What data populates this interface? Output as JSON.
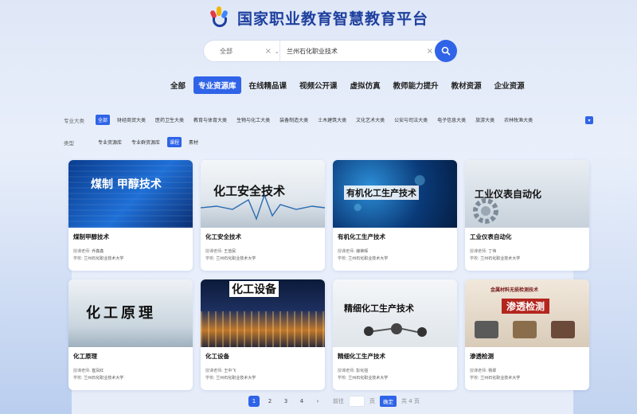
{
  "header": {
    "title": "国家职业教育智慧教育平台"
  },
  "search": {
    "scope_label": "全部",
    "query_value": "兰州石化职业技术"
  },
  "tabs": [
    {
      "label": "全部",
      "active": false
    },
    {
      "label": "专业资源库",
      "active": true
    },
    {
      "label": "在线精品课",
      "active": false
    },
    {
      "label": "视频公开课",
      "active": false
    },
    {
      "label": "虚拟仿真",
      "active": false
    },
    {
      "label": "教师能力提升",
      "active": false
    },
    {
      "label": "教材资源",
      "active": false
    },
    {
      "label": "企业资源",
      "active": false
    }
  ],
  "filters": {
    "category_label": "专业大类",
    "categories": [
      "全部",
      "财经商贸大类",
      "医药卫生大类",
      "教育与体育大类",
      "生物与化工大类",
      "装备制造大类",
      "土木建筑大类",
      "文化艺术大类",
      "公安与司法大类",
      "电子信息大类",
      "旅游大类",
      "农林牧渔大类"
    ],
    "type_label": "类型",
    "types": [
      "专业资源库",
      "专业群资源库",
      "课程",
      "素材"
    ],
    "type_active_index": 2
  },
  "cards": [
    {
      "thumb_text": "煤制 甲醇技术",
      "title": "煤制甲醇技术",
      "teacher_label": "授课老师:",
      "teacher": "乔鑫鑫",
      "school_label": "学校:",
      "school": "兰州石化职业技术大学"
    },
    {
      "thumb_text": "化工安全技术",
      "title": "化工安全技术",
      "teacher_label": "授课老师:",
      "teacher": "王皆民",
      "school_label": "学校:",
      "school": "兰州石化职业技术大学"
    },
    {
      "thumb_text": "有机化工生产技术",
      "title": "有机化工生产技术",
      "teacher_label": "授课老师:",
      "teacher": "薛荣晖",
      "school_label": "学校:",
      "school": "兰州石化职业技术大学"
    },
    {
      "thumb_text": "工业仪表自动化",
      "title": "工业仪表自动化",
      "teacher_label": "授课老师:",
      "teacher": "丁伟",
      "school_label": "学校:",
      "school": "兰州石化职业技术大学"
    },
    {
      "thumb_text": "化工原理",
      "title": "化工原理",
      "teacher_label": "授课老师:",
      "teacher": "崔凤红",
      "school_label": "学校:",
      "school": "兰州石化职业技术大学"
    },
    {
      "thumb_text": "化工设备",
      "title": "化工设备",
      "teacher_label": "授课老师:",
      "teacher": "王中飞",
      "school_label": "学校:",
      "school": "兰州石化职业技术大学"
    },
    {
      "thumb_text": "精细化工生产技术",
      "title": "精细化工生产技术",
      "teacher_label": "授课老师:",
      "teacher": "彭化强",
      "school_label": "学校:",
      "school": "兰州石化职业技术大学"
    },
    {
      "thumb_text": "渗透检测",
      "thumb_subtext": "金属材料无损检测技术",
      "title": "渗透检测",
      "teacher_label": "授课老师:",
      "teacher": "杨翠",
      "school_label": "学校:",
      "school": "兰州石化职业技术大学"
    }
  ],
  "pagination": {
    "pages": [
      "1",
      "2",
      "3",
      "4"
    ],
    "current": "1",
    "goto_prefix": "前往",
    "goto_suffix": "页",
    "confirm_label": "确定",
    "total_text": "共 4 页"
  },
  "colors": {
    "accent": "#2f64e8",
    "brand_title": "#1d3f9e"
  }
}
